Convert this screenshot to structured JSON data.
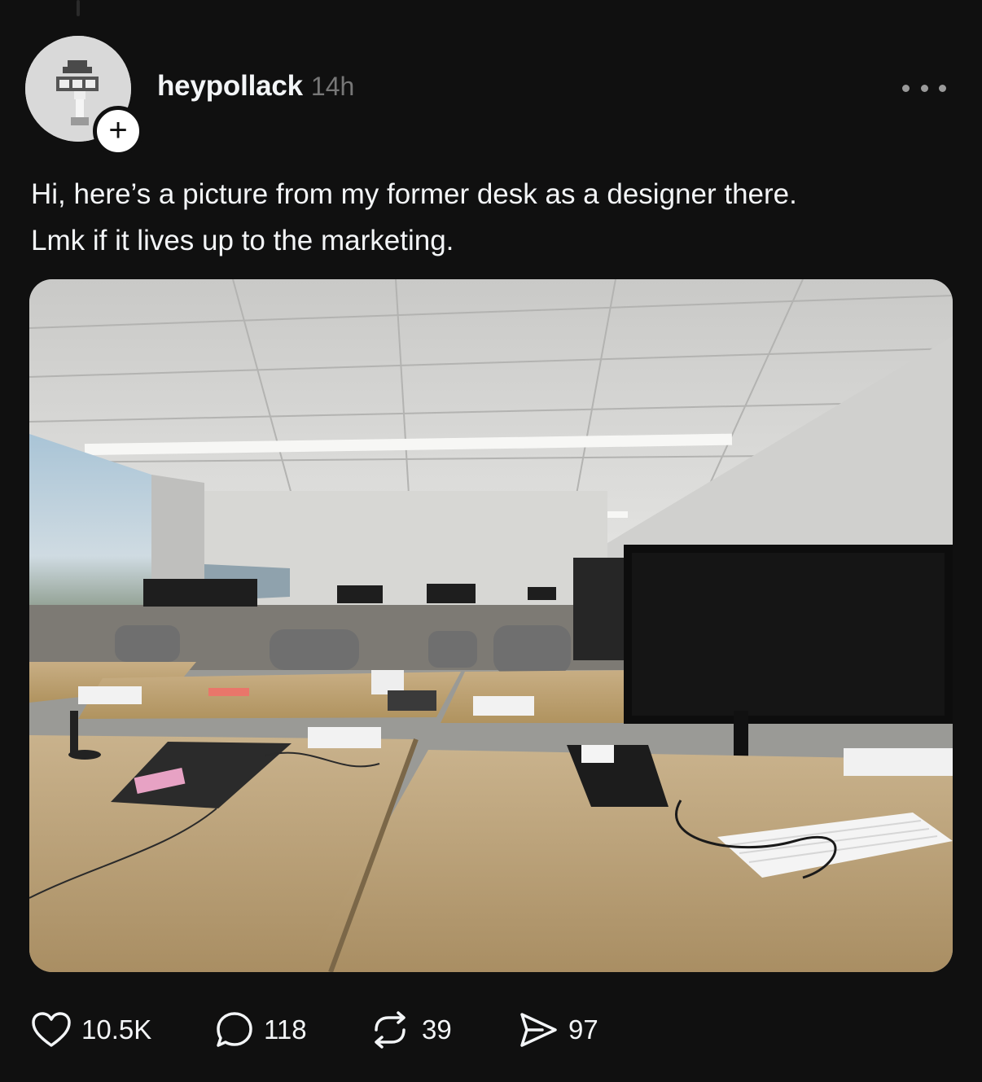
{
  "post": {
    "username": "heypollack",
    "timestamp": "14h",
    "follow_symbol": "+",
    "text_lines": [
      "Hi, here’s a picture from my former desk as a designer there.",
      "Lmk if it lives up to the marketing."
    ],
    "image": {
      "description_icon": "office-photo"
    }
  },
  "actions": {
    "like": {
      "icon": "heart-icon",
      "count": "10.5K"
    },
    "reply": {
      "icon": "speech-bubble-icon",
      "count": "118"
    },
    "repost": {
      "icon": "repost-icon",
      "count": "39"
    },
    "share": {
      "icon": "send-icon",
      "count": "97"
    }
  },
  "colors": {
    "background": "#101010",
    "text_primary": "#f3f5f7",
    "text_secondary": "#777777"
  }
}
